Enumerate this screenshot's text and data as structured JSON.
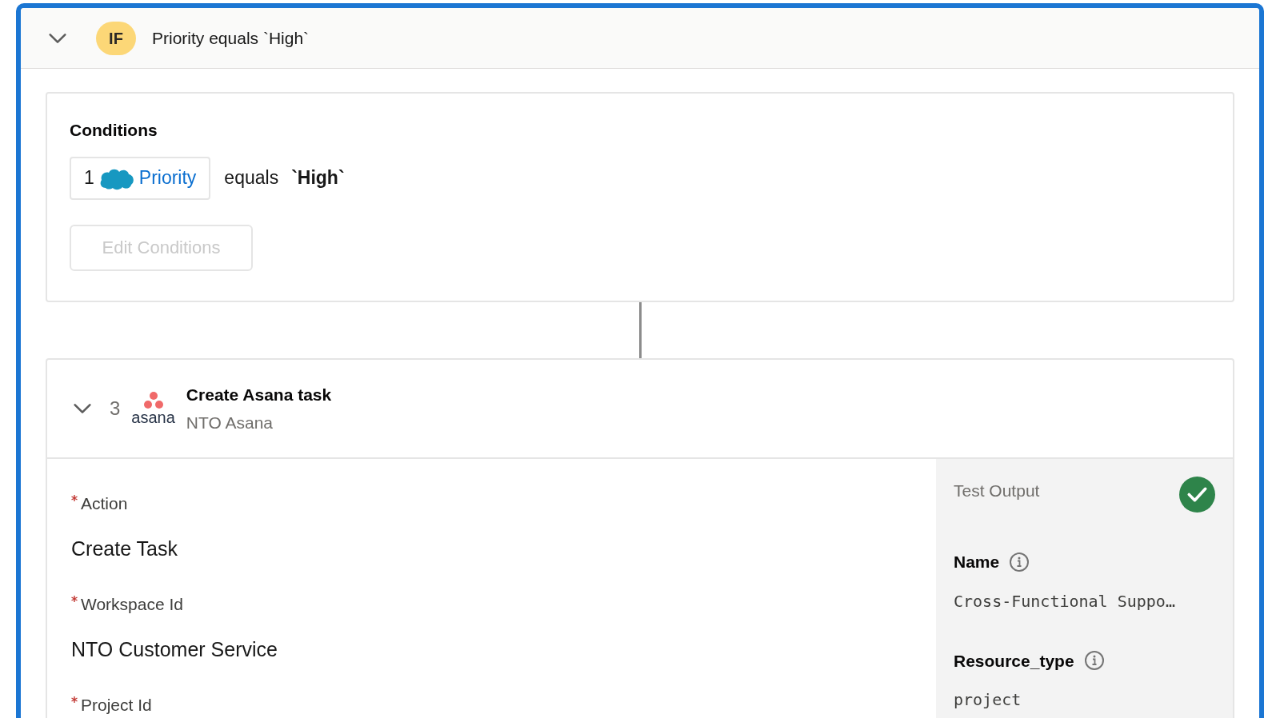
{
  "if_header": {
    "expanded": true,
    "badge": "IF",
    "summary": "Priority equals `High`"
  },
  "conditions": {
    "title": "Conditions",
    "items": [
      {
        "index": "1",
        "field": "Priority",
        "operator": "equals",
        "value": "`High`"
      }
    ],
    "edit_button": {
      "label": "Edit Conditions",
      "disabled": true
    }
  },
  "step": {
    "expanded": true,
    "number": "3",
    "logo_text": "asana",
    "title": "Create Asana task",
    "subtitle": "NTO Asana",
    "fields": [
      {
        "label": "Action",
        "required": true,
        "value": "Create Task"
      },
      {
        "label": "Workspace Id",
        "required": true,
        "value": "NTO Customer Service"
      },
      {
        "label": "Project Id",
        "required": true
      }
    ],
    "test_output": {
      "title": "Test Output",
      "passed": true,
      "fields": [
        {
          "label": "Name",
          "value": "Cross-Functional Suppo…"
        },
        {
          "label": "Resource_type",
          "value": "project"
        }
      ]
    }
  }
}
